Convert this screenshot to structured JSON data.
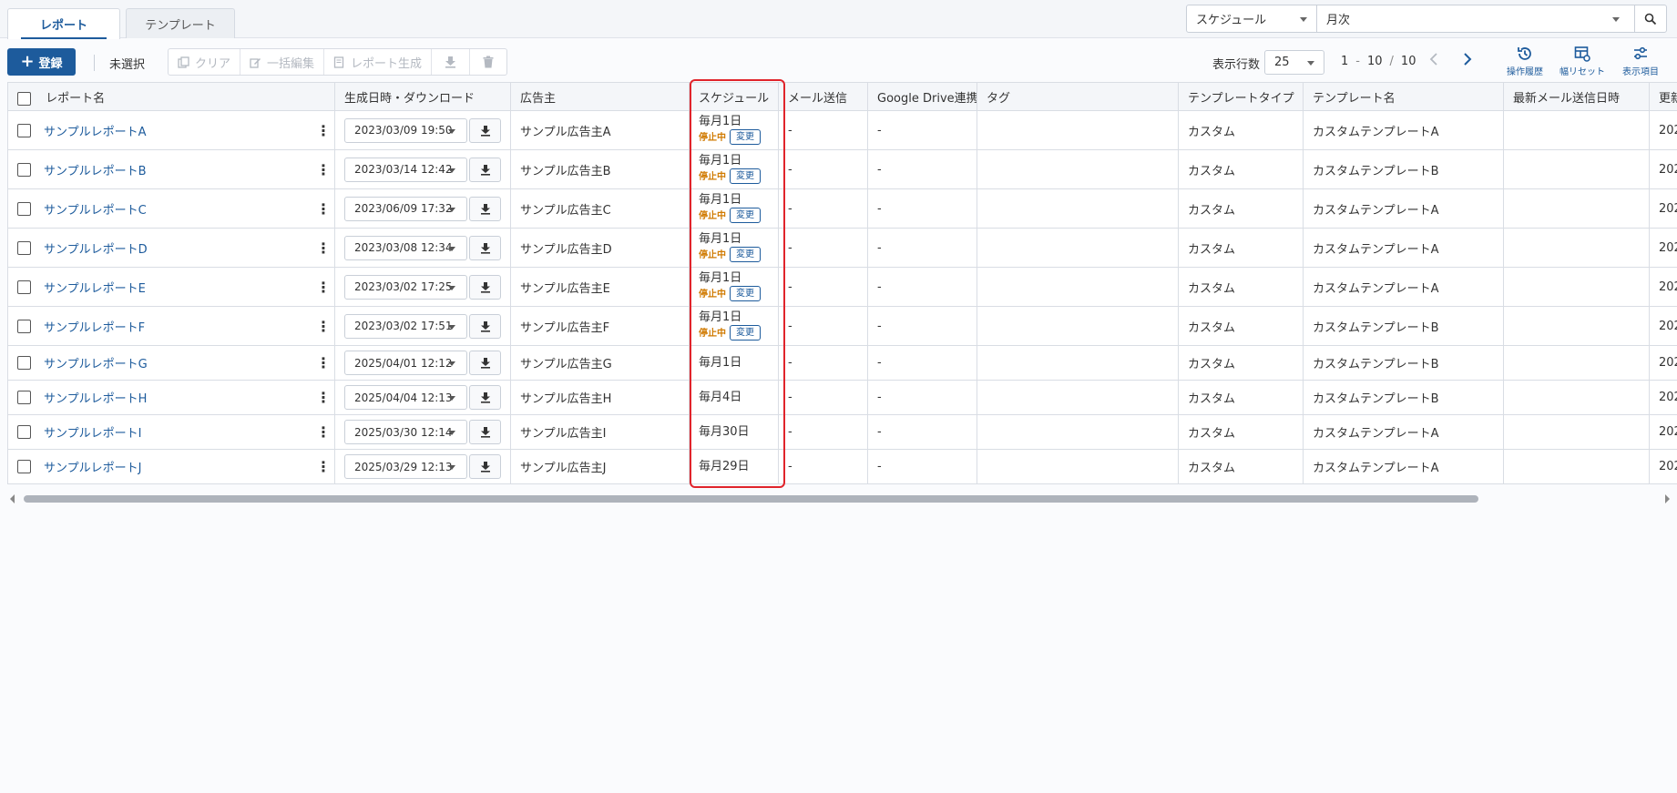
{
  "tabs": [
    {
      "label": "レポート",
      "active": true
    },
    {
      "label": "テンプレート",
      "active": false
    }
  ],
  "filter": {
    "field": "スケジュール",
    "value": "月次"
  },
  "toolbar": {
    "register_label": "登録",
    "selection_status": "未選択",
    "clear_label": "クリア",
    "bulk_edit_label": "一括編集",
    "generate_label": "レポート生成"
  },
  "pagination": {
    "rows_label": "表示行数",
    "rows_per_page": "25",
    "range_start": "1",
    "range_end": "10",
    "range_sep": "-",
    "total_sep": "/",
    "total": "10"
  },
  "actions": {
    "history_label": "操作履歴",
    "reset_width_label": "幅リセット",
    "display_items_label": "表示項目"
  },
  "columns": [
    "レポート名",
    "生成日時・ダウンロード",
    "広告主",
    "スケジュール",
    "メール送信",
    "Google Drive連携",
    "タグ",
    "テンプレートタイプ",
    "テンプレート名",
    "最新メール送信日時",
    "更新"
  ],
  "schedule_status_label": "停止中",
  "schedule_change_label": "変更",
  "rows": [
    {
      "name": "サンプルレポートA",
      "generated": "2023/03/09 19:50",
      "advertiser": "サンプル広告主A",
      "schedule": "毎月1日",
      "stopped": true,
      "mail": "-",
      "drive": "-",
      "tag": "",
      "template_type": "カスタム",
      "template_name": "カスタムテンプレートA",
      "last_mail": "",
      "updated": "202"
    },
    {
      "name": "サンプルレポートB",
      "generated": "2023/03/14 12:42",
      "advertiser": "サンプル広告主B",
      "schedule": "毎月1日",
      "stopped": true,
      "mail": "-",
      "drive": "-",
      "tag": "",
      "template_type": "カスタム",
      "template_name": "カスタムテンプレートB",
      "last_mail": "",
      "updated": "202"
    },
    {
      "name": "サンプルレポートC",
      "generated": "2023/06/09 17:32",
      "advertiser": "サンプル広告主C",
      "schedule": "毎月1日",
      "stopped": true,
      "mail": "-",
      "drive": "-",
      "tag": "",
      "template_type": "カスタム",
      "template_name": "カスタムテンプレートA",
      "last_mail": "",
      "updated": "202"
    },
    {
      "name": "サンプルレポートD",
      "generated": "2023/03/08 12:34",
      "advertiser": "サンプル広告主D",
      "schedule": "毎月1日",
      "stopped": true,
      "mail": "-",
      "drive": "-",
      "tag": "",
      "template_type": "カスタム",
      "template_name": "カスタムテンプレートA",
      "last_mail": "",
      "updated": "202"
    },
    {
      "name": "サンプルレポートE",
      "generated": "2023/03/02 17:25",
      "advertiser": "サンプル広告主E",
      "schedule": "毎月1日",
      "stopped": true,
      "mail": "-",
      "drive": "-",
      "tag": "",
      "template_type": "カスタム",
      "template_name": "カスタムテンプレートA",
      "last_mail": "",
      "updated": "202"
    },
    {
      "name": "サンプルレポートF",
      "generated": "2023/03/02 17:51",
      "advertiser": "サンプル広告主F",
      "schedule": "毎月1日",
      "stopped": true,
      "mail": "-",
      "drive": "-",
      "tag": "",
      "template_type": "カスタム",
      "template_name": "カスタムテンプレートB",
      "last_mail": "",
      "updated": "202"
    },
    {
      "name": "サンプルレポートG",
      "generated": "2025/04/01 12:12",
      "advertiser": "サンプル広告主G",
      "schedule": "毎月1日",
      "stopped": false,
      "mail": "-",
      "drive": "-",
      "tag": "",
      "template_type": "カスタム",
      "template_name": "カスタムテンプレートB",
      "last_mail": "",
      "updated": "202"
    },
    {
      "name": "サンプルレポートH",
      "generated": "2025/04/04 12:13",
      "advertiser": "サンプル広告主H",
      "schedule": "毎月4日",
      "stopped": false,
      "mail": "-",
      "drive": "-",
      "tag": "",
      "template_type": "カスタム",
      "template_name": "カスタムテンプレートB",
      "last_mail": "",
      "updated": "202"
    },
    {
      "name": "サンプルレポートI",
      "generated": "2025/03/30 12:14",
      "advertiser": "サンプル広告主I",
      "schedule": "毎月30日",
      "stopped": false,
      "mail": "-",
      "drive": "-",
      "tag": "",
      "template_type": "カスタム",
      "template_name": "カスタムテンプレートA",
      "last_mail": "",
      "updated": "202"
    },
    {
      "name": "サンプルレポートJ",
      "generated": "2025/03/29 12:13",
      "advertiser": "サンプル広告主J",
      "schedule": "毎月29日",
      "stopped": false,
      "mail": "-",
      "drive": "-",
      "tag": "",
      "template_type": "カスタム",
      "template_name": "カスタムテンプレートA",
      "last_mail": "",
      "updated": "202"
    }
  ],
  "colors": {
    "primary": "#1d5b9c",
    "stopped": "#d07a00",
    "highlight": "#e0242b"
  }
}
